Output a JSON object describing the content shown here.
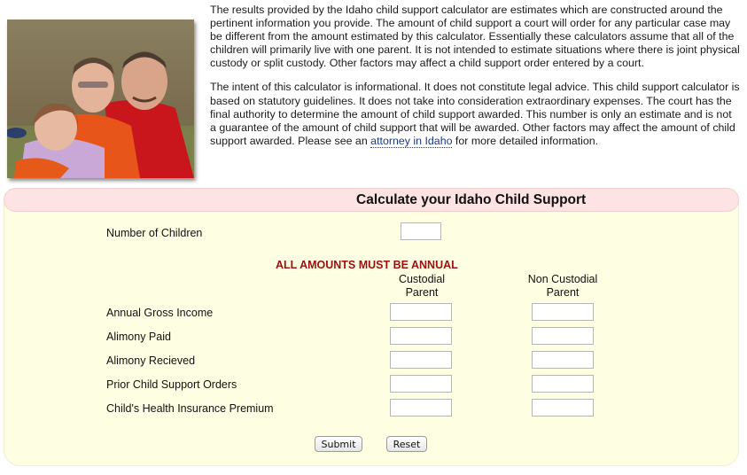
{
  "intro": {
    "paragraph1": "The results provided by the Idaho child support calculator are estimates which are constructed around the pertinent information you provide. The amount of child support a court will order for any particular case may be different from the amount estimated by this calculator. Essentially these calculators assume that all of the children will primarily live with one parent. It is not intended to estimate situations where there is joint physical custody or split custody. Other factors may affect a child support order entered by a court.",
    "paragraph2_before_link": "The intent of this calculator is informational. It does not constitute legal advice. This child support calculator is based on statutory guidelines. It does not take into consideration extraordinary expenses. The court has the final authority to determine the amount of child support awarded. This number is only an estimate and is not a guarantee of the amount of child support that will be awarded. Other factors may affect the amount of child support awarded. Please see an ",
    "paragraph2_link": "attorney in Idaho",
    "paragraph2_after_link": " for more detailed information.",
    "photo_alt": "Family photo: father with two smiling children"
  },
  "calculator": {
    "title": "Calculate your Idaho Child Support",
    "num_children_label": "Number of Children",
    "num_children_value": "",
    "annual_note": "ALL AMOUNTS MUST BE ANNUAL",
    "columns": {
      "custodial": "Custodial Parent",
      "custodial_line1": "Custodial",
      "custodial_line2": "Parent",
      "noncustodial": "Non Custodial Parent",
      "noncustodial_line1": "Non Custodial",
      "noncustodial_line2": "Parent"
    },
    "rows": [
      {
        "label": "Annual Gross Income",
        "custodial": "",
        "noncustodial": ""
      },
      {
        "label": "Alimony Paid",
        "custodial": "",
        "noncustodial": ""
      },
      {
        "label": "Alimony Recieved",
        "custodial": "",
        "noncustodial": ""
      },
      {
        "label": "Prior Child Support Orders",
        "custodial": "",
        "noncustodial": ""
      },
      {
        "label": "Child's Health Insurance Premium",
        "custodial": "",
        "noncustodial": ""
      }
    ],
    "submit_label": "Submit",
    "reset_label": "Reset"
  },
  "colors": {
    "header_bg": "#fde3e3",
    "panel_bg": "#fefee2",
    "note_red": "#9b1010",
    "link_blue": "#1a3a8a"
  }
}
